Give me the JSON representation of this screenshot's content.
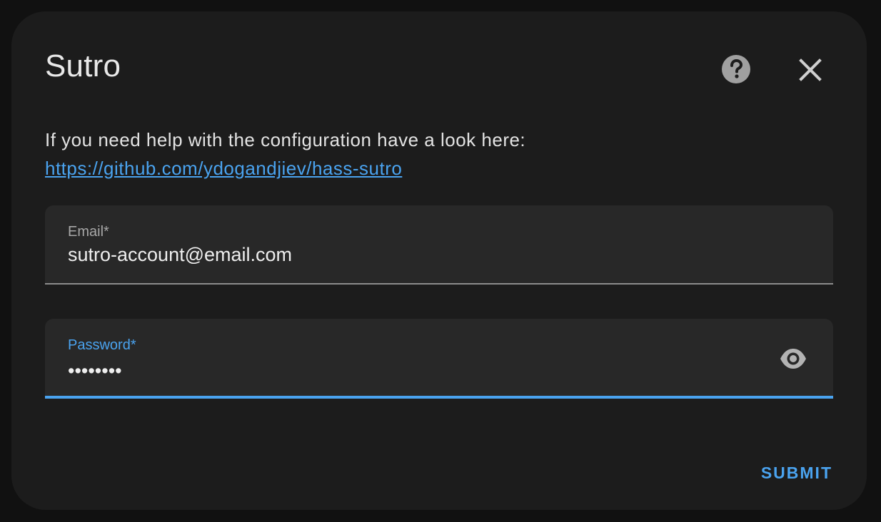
{
  "dialog": {
    "title": "Sutro",
    "help_icon": "help-circle-icon",
    "close_icon": "close-icon",
    "description": "If you need help with the configuration have a look here:",
    "link_text": "https://github.com/ydogandjiev/hass-sutro"
  },
  "form": {
    "email": {
      "label": "Email*",
      "value": "sutro-account@email.com"
    },
    "password": {
      "label": "Password*",
      "value": "••••••••",
      "toggle_icon": "eye-icon"
    },
    "submit_label": "SUBMIT"
  },
  "colors": {
    "accent": "#4aa3ef",
    "background": "#1c1c1c",
    "field_background": "#282828"
  }
}
